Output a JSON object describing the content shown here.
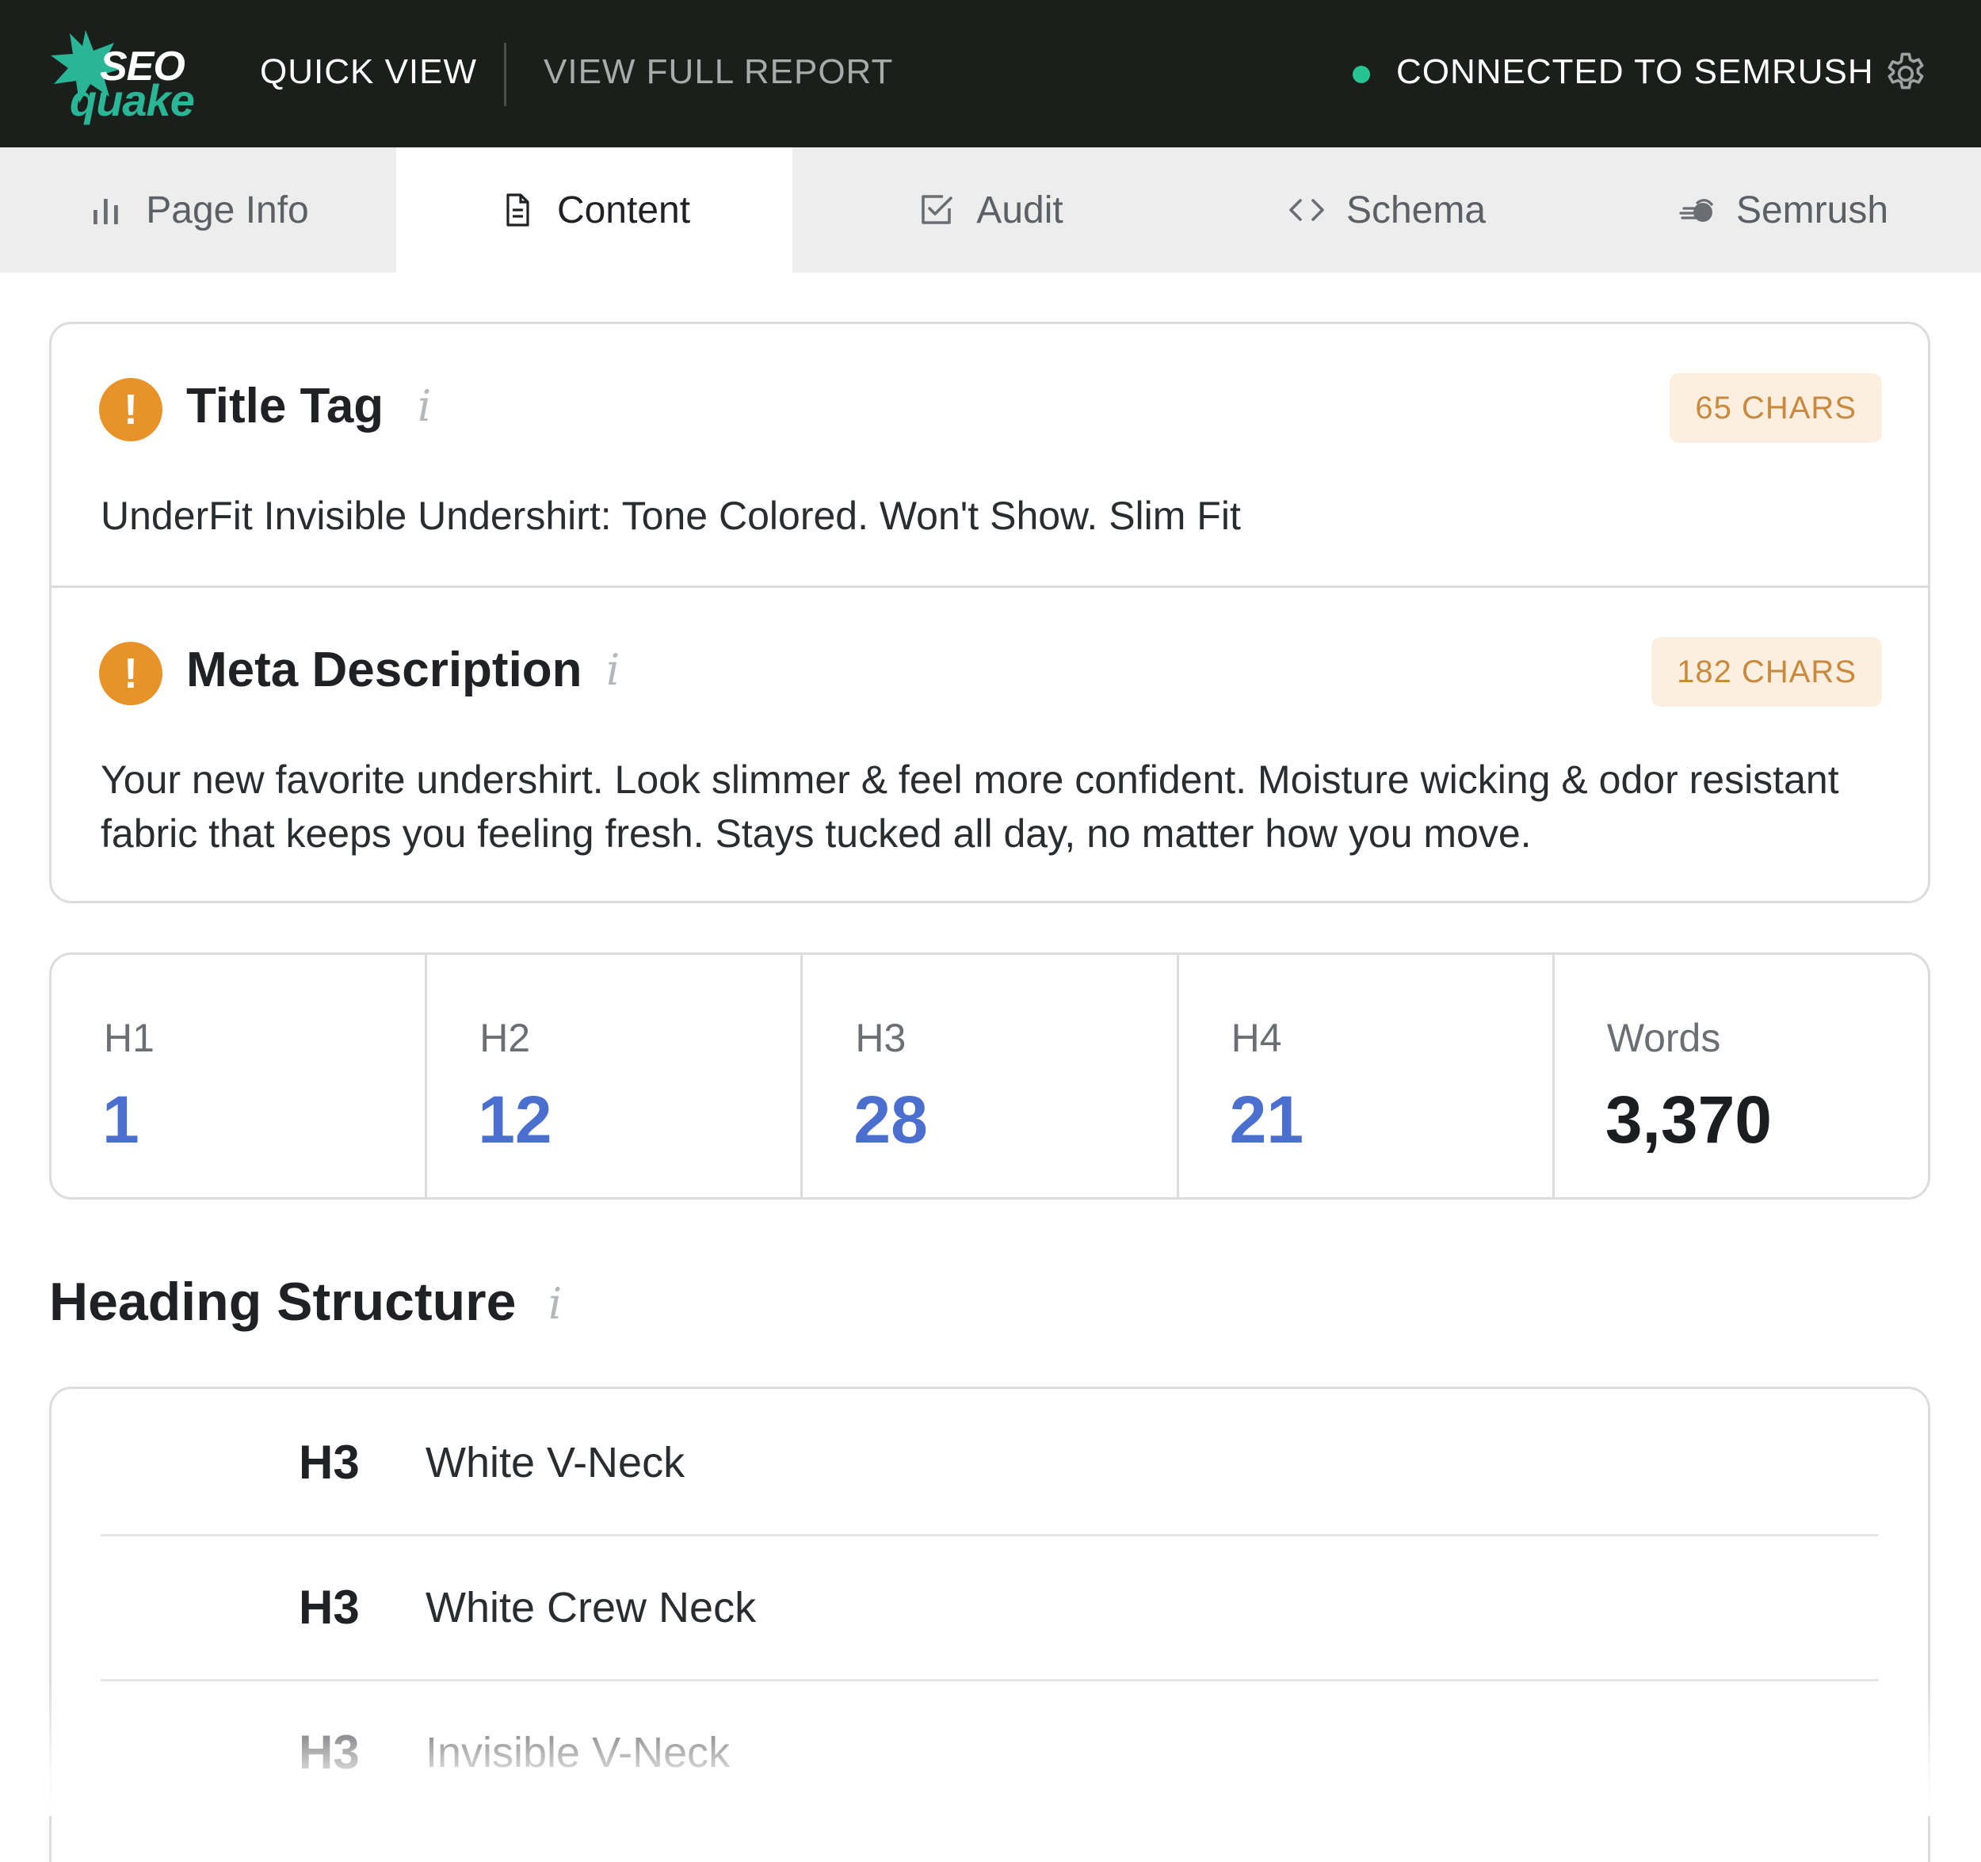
{
  "header": {
    "logo_seo": "SEO",
    "logo_quake": "quake",
    "quick_view": "QUICK VIEW",
    "full_report": "VIEW FULL REPORT",
    "status": "CONNECTED TO SEMRUSH",
    "status_color": "#27c393",
    "settings_icon": "gear-icon"
  },
  "tabs": [
    {
      "label": "Page Info",
      "icon": "bar-chart-icon"
    },
    {
      "label": "Content",
      "icon": "document-icon",
      "active": true
    },
    {
      "label": "Audit",
      "icon": "checkbox-icon"
    },
    {
      "label": "Schema",
      "icon": "code-brackets-icon"
    },
    {
      "label": "Semrush",
      "icon": "semrush-fireball-icon"
    }
  ],
  "title_tag": {
    "heading": "Title Tag",
    "badge": "65 CHARS",
    "text": "UnderFit Invisible Undershirt: Tone Colored. Won't Show. Slim Fit",
    "warn_symbol": "!"
  },
  "meta_description": {
    "heading": "Meta Description",
    "badge": "182 CHARS",
    "text": "Your new favorite undershirt. Look slimmer & feel more confident. Moisture wicking & odor resistant fabric that keeps you feeling fresh. Stays tucked all day, no matter how you move.",
    "warn_symbol": "!"
  },
  "info_symbol": "i",
  "stats": [
    {
      "label": "H1",
      "value": "1"
    },
    {
      "label": "H2",
      "value": "12"
    },
    {
      "label": "H3",
      "value": "28"
    },
    {
      "label": "H4",
      "value": "21"
    },
    {
      "label": "Words",
      "value": "3,370"
    }
  ],
  "heading_structure": {
    "title": "Heading Structure",
    "rows": [
      {
        "tag": "H3",
        "text": "White V-Neck"
      },
      {
        "tag": "H3",
        "text": "White Crew Neck"
      },
      {
        "tag": "H3",
        "text": "Invisible V-Neck"
      }
    ]
  },
  "colors": {
    "accent_warn": "#e8922a",
    "stat_blue": "#4a6fcf",
    "brand_green": "#2bb597",
    "topbar": "#1b1f1c"
  }
}
